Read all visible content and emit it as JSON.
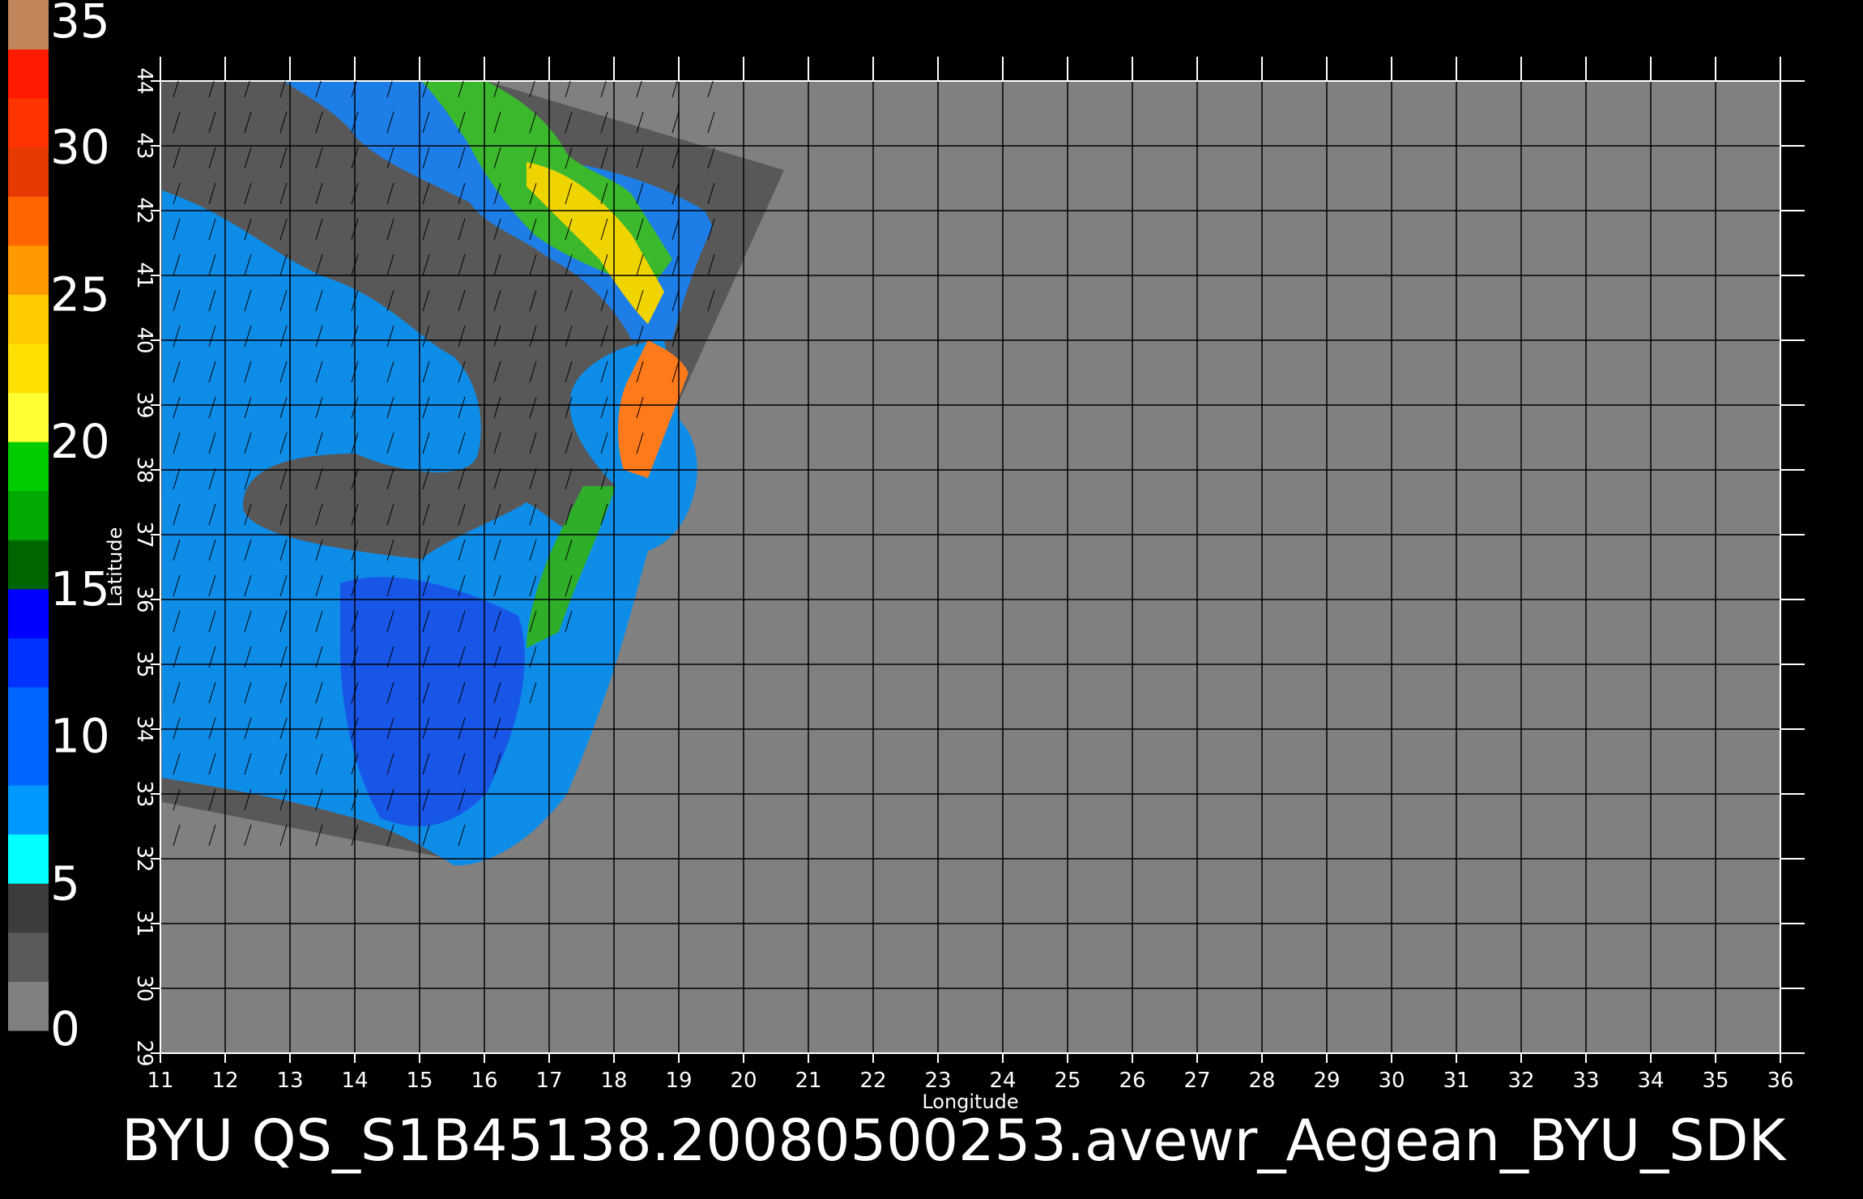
{
  "title": "BYU  QS_S1B45138.20080500253.avewr_Aegean_BYU_SDK",
  "colorbar": {
    "min": 0,
    "max": 35,
    "labels": [
      "35",
      "30",
      "25",
      "20",
      "15",
      "10",
      "5",
      "0"
    ],
    "label_values": [
      35,
      30,
      25,
      20,
      15,
      10,
      5,
      0
    ],
    "colors": {
      "0_5": [
        "#808080",
        "#5a5a5a",
        "#3c3c3c"
      ],
      "5_10": [
        "#00ffff",
        "#0099ff",
        "#0066ff"
      ],
      "10_15": [
        "#0066ff",
        "#0033ff",
        "#0000ff"
      ],
      "15_20": [
        "#006600",
        "#00aa00",
        "#00cc00"
      ],
      "20_25": [
        "#ffff33",
        "#ffe000",
        "#ffcc00"
      ],
      "25_30": [
        "#ff9900",
        "#ff6600",
        "#e83a00"
      ],
      "30_35": [
        "#ff3300",
        "#ff1a00",
        "#c0855a"
      ]
    }
  },
  "axes": {
    "xlabel": "Longitude",
    "ylabel": "Latitude",
    "x_ticks": [
      "11",
      "12",
      "13",
      "14",
      "15",
      "16",
      "17",
      "18",
      "19",
      "20",
      "21",
      "22",
      "23",
      "24",
      "25",
      "26",
      "27",
      "28",
      "29",
      "30",
      "31",
      "32",
      "33",
      "34",
      "35",
      "36"
    ],
    "y_ticks": [
      "29",
      "30",
      "31",
      "32",
      "33",
      "34",
      "35",
      "36",
      "37",
      "38",
      "39",
      "40",
      "41",
      "42",
      "43",
      "44"
    ],
    "xlim": [
      11,
      36
    ],
    "ylim": [
      29,
      44
    ]
  },
  "style": {
    "background": "#000000",
    "plot_bg": "#808080",
    "swath_bg": "#585858",
    "grid": "#000000",
    "axis": "#ffffff"
  }
}
